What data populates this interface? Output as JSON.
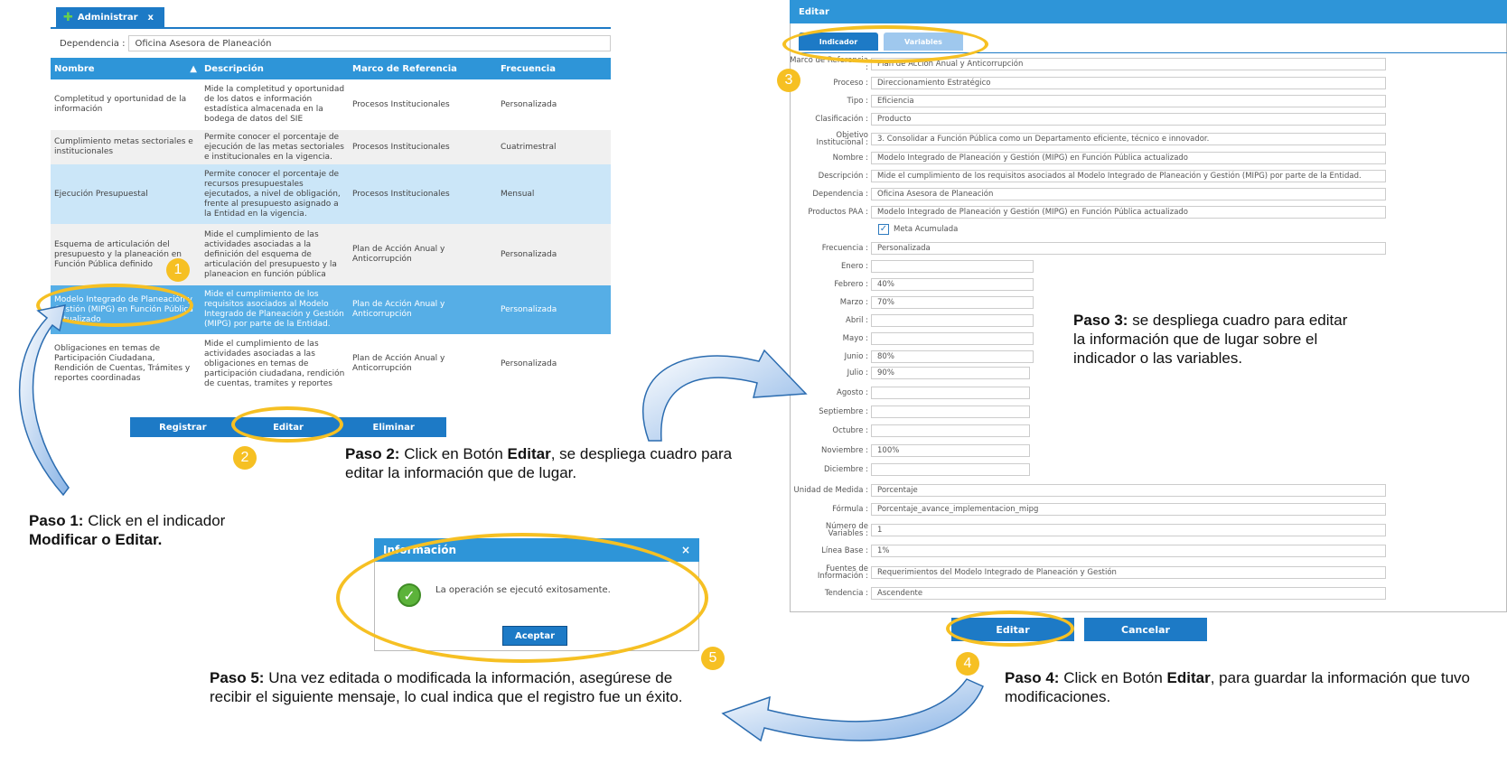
{
  "admin_tab": {
    "label": "Administrar",
    "close": "x"
  },
  "dependency": {
    "label": "Dependencia :",
    "value": "Oficina Asesora de Planeación"
  },
  "indicator_table": {
    "columns": [
      "Nombre",
      "Descripción",
      "Marco de Referencia",
      "Frecuencia"
    ],
    "rows": [
      {
        "nombre": "Completitud y oportunidad de la información",
        "descripcion": "Mide la completitud y oportunidad de los datos e información estadística almacenada en la bodega de datos del SIE",
        "marco": "Procesos Institucionales",
        "frecuencia": "Personalizada"
      },
      {
        "nombre": "Cumplimiento metas sectoriales e institucionales",
        "descripcion": "Permite conocer el porcentaje de ejecución de las metas sectoriales e institucionales en la vigencia.",
        "marco": "Procesos Institucionales",
        "frecuencia": "Cuatrimestral"
      },
      {
        "nombre": "Ejecución Presupuestal",
        "descripcion": "Permite conocer el porcentaje de recursos presupuestales ejecutados, a nivel de obligación, frente al presupuesto asignado a la Entidad en la vigencia.",
        "marco": "Procesos Institucionales",
        "frecuencia": "Mensual"
      },
      {
        "nombre": "Esquema de articulación del presupuesto y la planeación en Función Pública definido",
        "descripcion": "Mide el cumplimiento de las actividades asociadas a la definición del esquema de articulación del presupuesto y la planeacion en función pública",
        "marco": "Plan de Acción Anual y Anticorrupción",
        "frecuencia": "Personalizada"
      },
      {
        "nombre": "Modelo Integrado de Planeación y Gestión (MIPG) en Función Pública actualizado",
        "descripcion": "Mide el cumplimiento de los requisitos asociados al Modelo Integrado de Planeación y Gestión (MIPG) por parte de la Entidad.",
        "marco": "Plan de Acción Anual y Anticorrupción",
        "frecuencia": "Personalizada"
      },
      {
        "nombre": "Obligaciones en temas de Participación Ciudadana, Rendición de Cuentas, Trámites y reportes coordinadas",
        "descripcion": "Mide el cumplimiento de las actividades asociadas a las obligaciones en temas de participación ciudadana, rendición de cuentas, tramites y reportes",
        "marco": "Plan de Acción Anual y Anticorrupción",
        "frecuencia": "Personalizada"
      }
    ]
  },
  "left_buttons": {
    "registrar": "Registrar",
    "editar": "Editar",
    "eliminar": "Eliminar"
  },
  "edit_window": {
    "title": "Editar",
    "tabs": [
      "Indicador",
      "Variables"
    ],
    "fields": {
      "marco": {
        "label": "Marco de Referencia :",
        "value": "Plan de Acción Anual y Anticorrupción"
      },
      "proceso": {
        "label": "Proceso :",
        "value": "Direccionamiento Estratégico"
      },
      "tipo": {
        "label": "Tipo :",
        "value": "Eficiencia"
      },
      "clasificacion": {
        "label": "Clasificación :",
        "value": "Producto"
      },
      "objetivo": {
        "label": "Objetivo Institucional :",
        "value": "3. Consolidar a Función Pública como un Departamento eficiente, técnico e innovador."
      },
      "nombre": {
        "label": "Nombre :",
        "value": "Modelo Integrado de Planeación y Gestión (MIPG) en Función Pública actualizado"
      },
      "descripcion": {
        "label": "Descripción :",
        "value": "Mide el cumplimiento de los requisitos asociados al Modelo Integrado de Planeación y Gestión (MIPG) por parte de la Entidad."
      },
      "dependencia": {
        "label": "Dependencia :",
        "value": "Oficina Asesora de Planeación"
      },
      "productos": {
        "label": "Productos PAA :",
        "value": "Modelo Integrado de Planeación y Gestión (MIPG) en Función Pública actualizado"
      },
      "meta_acumulada": {
        "label": "Meta Acumulada",
        "checked": "✓"
      },
      "frecuencia": {
        "label": "Frecuencia :",
        "value": "Personalizada"
      },
      "enero": {
        "label": "Enero :",
        "value": ""
      },
      "febrero": {
        "label": "Febrero :",
        "value": "40%"
      },
      "marzo": {
        "label": "Marzo :",
        "value": "70%"
      },
      "abril": {
        "label": "Abril :",
        "value": ""
      },
      "mayo": {
        "label": "Mayo :",
        "value": ""
      },
      "junio": {
        "label": "Junio :",
        "value": "80%"
      },
      "julio": {
        "label": "Julio :",
        "value": "90%"
      },
      "agosto": {
        "label": "Agosto :",
        "value": ""
      },
      "septiembre": {
        "label": "Septiembre :",
        "value": ""
      },
      "octubre": {
        "label": "Octubre :",
        "value": ""
      },
      "noviembre": {
        "label": "Noviembre :",
        "value": "100%"
      },
      "diciembre": {
        "label": "Diciembre :",
        "value": ""
      },
      "unidad": {
        "label": "Unidad de Medida :",
        "value": "Porcentaje"
      },
      "formula": {
        "label": "Fórmula :",
        "value": "Porcentaje_avance_implementacion_mipg"
      },
      "num_variables": {
        "label": "Número de Variables :",
        "value": "1"
      },
      "linea_base": {
        "label": "Línea Base :",
        "value": "1%"
      },
      "fuentes": {
        "label": "Fuentes de Información :",
        "value": "Requerimientos del Modelo Integrado de Planeación y Gestión"
      },
      "tendencia": {
        "label": "Tendencia :",
        "value": "Ascendente"
      }
    },
    "buttons": {
      "editar": "Editar",
      "cancelar": "Cancelar"
    }
  },
  "info_dialog": {
    "title": "Información",
    "close": "×",
    "message": "La operación se ejecutó exitosamente.",
    "button": "Aceptar"
  },
  "steps": {
    "badge1": "1",
    "badge2": "2",
    "badge3": "3",
    "badge4": "4",
    "badge5": "5",
    "paso1_head": "Paso 1:",
    "paso1_text": " Click en el indicador ",
    "paso1_bold": "Modificar o Editar.",
    "paso2_head": "Paso 2:",
    "paso2_text_a": " Click en Botón ",
    "paso2_bold": "Editar",
    "paso2_text_b": ", se despliega cuadro para editar la  información que de lugar.",
    "paso3_head": "Paso 3:",
    "paso3_text": " se  despliega cuadro para editar la  información que de lugar sobre el indicador o las variables.",
    "paso4_head": "Paso 4:",
    "paso4_text_a": " Click en Botón ",
    "paso4_bold": "Editar",
    "paso4_text_b": ", para  guardar la información que tuvo modificaciones.",
    "paso5_head": "Paso 5:",
    "paso5_text": " Una vez editada o modificada la información, asegúrese de recibir el siguiente mensaje,  lo cual indica que el registro fue un éxito."
  },
  "colors": {
    "accent": "#1d7ac6",
    "header": "#2e95d8",
    "highlight": "#f6c023",
    "selected_row": "#56aee6"
  }
}
